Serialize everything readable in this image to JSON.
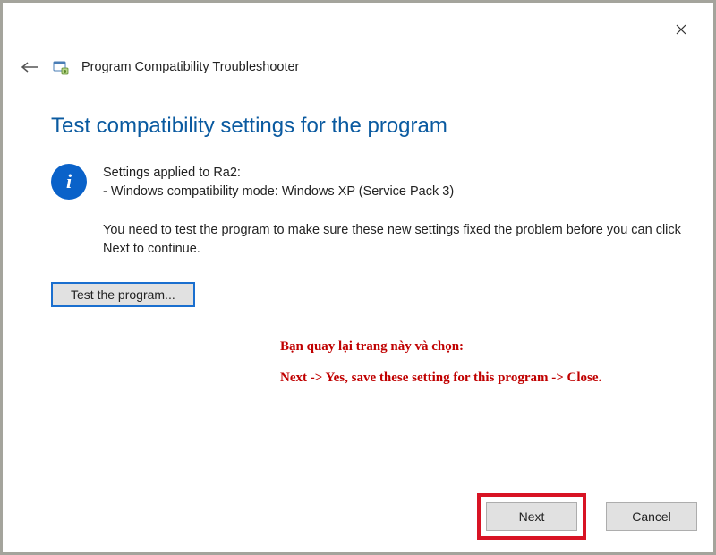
{
  "wizard": {
    "title": "Program Compatibility Troubleshooter"
  },
  "page": {
    "heading": "Test compatibility settings for the program",
    "settings_line1": "Settings applied to Ra2:",
    "settings_line2": "- Windows compatibility mode: Windows XP (Service Pack 3)",
    "instruction": "You need to test the program to make sure these new settings fixed the problem before you can click Next to continue.",
    "test_button": "Test the program..."
  },
  "annotation": {
    "line1": "Bạn quay lại trang này và chọn:",
    "line2": "Next -> Yes, save these setting for this program -> Close."
  },
  "footer": {
    "next": "Next",
    "cancel": "Cancel"
  }
}
